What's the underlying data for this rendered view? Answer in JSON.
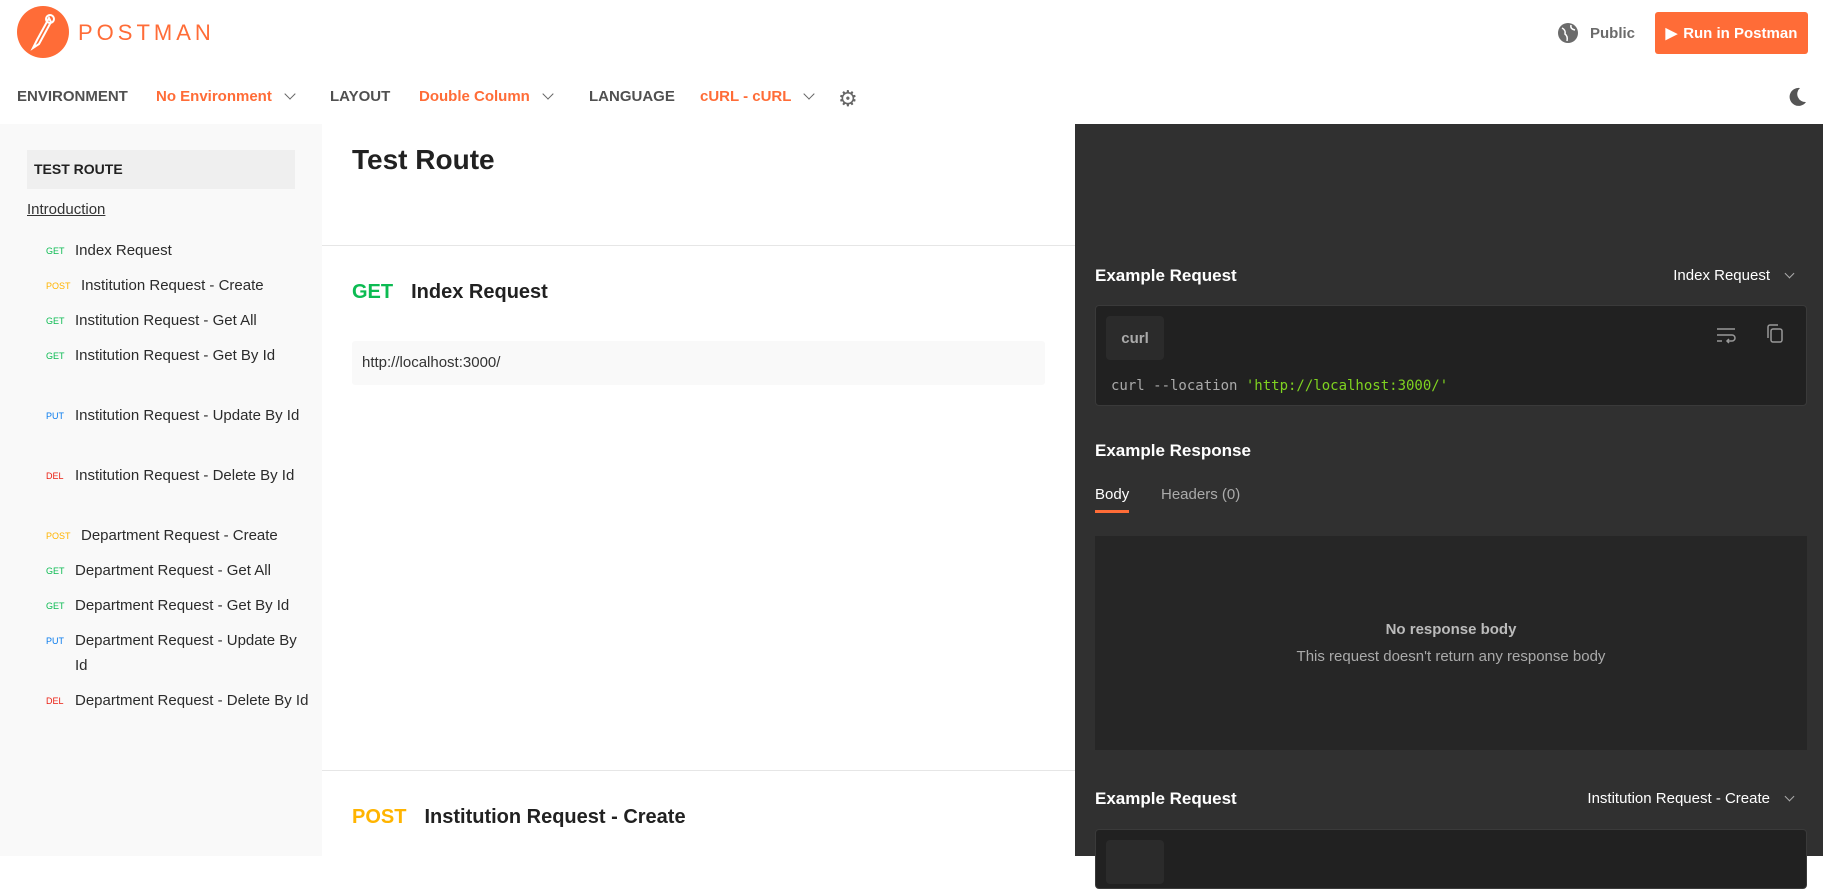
{
  "brand": {
    "name": "POSTMAN",
    "accent": "#ff6c37"
  },
  "header": {
    "public_label": "Public",
    "run_label": "Run in Postman"
  },
  "toolbar": {
    "environment_label": "ENVIRONMENT",
    "environment_value": "No Environment",
    "layout_label": "LAYOUT",
    "layout_value": "Double Column",
    "language_label": "LANGUAGE",
    "language_value": "cURL - cURL"
  },
  "sidebar": {
    "heading": "TEST ROUTE",
    "intro": "Introduction",
    "items": [
      {
        "method": "GET",
        "label": "Index Request"
      },
      {
        "method": "POST",
        "label": "Institution Request - Create"
      },
      {
        "method": "GET",
        "label": "Institution Request - Get All"
      },
      {
        "method": "GET",
        "label": "Institution Request - Get By Id"
      },
      {
        "method": "PUT",
        "label": "Institution Request - Update By Id"
      },
      {
        "method": "DEL",
        "label": "Institution Request - Delete By Id"
      },
      {
        "method": "POST",
        "label": "Department Request - Create"
      },
      {
        "method": "GET",
        "label": "Department Request - Get All"
      },
      {
        "method": "GET",
        "label": "Department Request - Get By Id"
      },
      {
        "method": "PUT",
        "label": "Department Request - Update By Id"
      },
      {
        "method": "DEL",
        "label": "Department Request - Delete By Id"
      }
    ]
  },
  "main": {
    "title": "Test Route",
    "requests": [
      {
        "method": "GET",
        "name": "Index Request",
        "url": "http://localhost:3000/"
      },
      {
        "method": "POST",
        "name": "Institution Request - Create"
      }
    ]
  },
  "panel": {
    "example_request": "Example Request",
    "selected_1": "Index Request",
    "lang_tag": "curl",
    "code_cmd": "curl --location ",
    "code_url": "'http://localhost:3000/'",
    "example_response": "Example Response",
    "tab_body": "Body",
    "tab_headers": "Headers (0)",
    "empty_title": "No response body",
    "empty_sub": "This request doesn't return any response body",
    "example_request_2": "Example Request",
    "selected_2": "Institution Request - Create"
  }
}
